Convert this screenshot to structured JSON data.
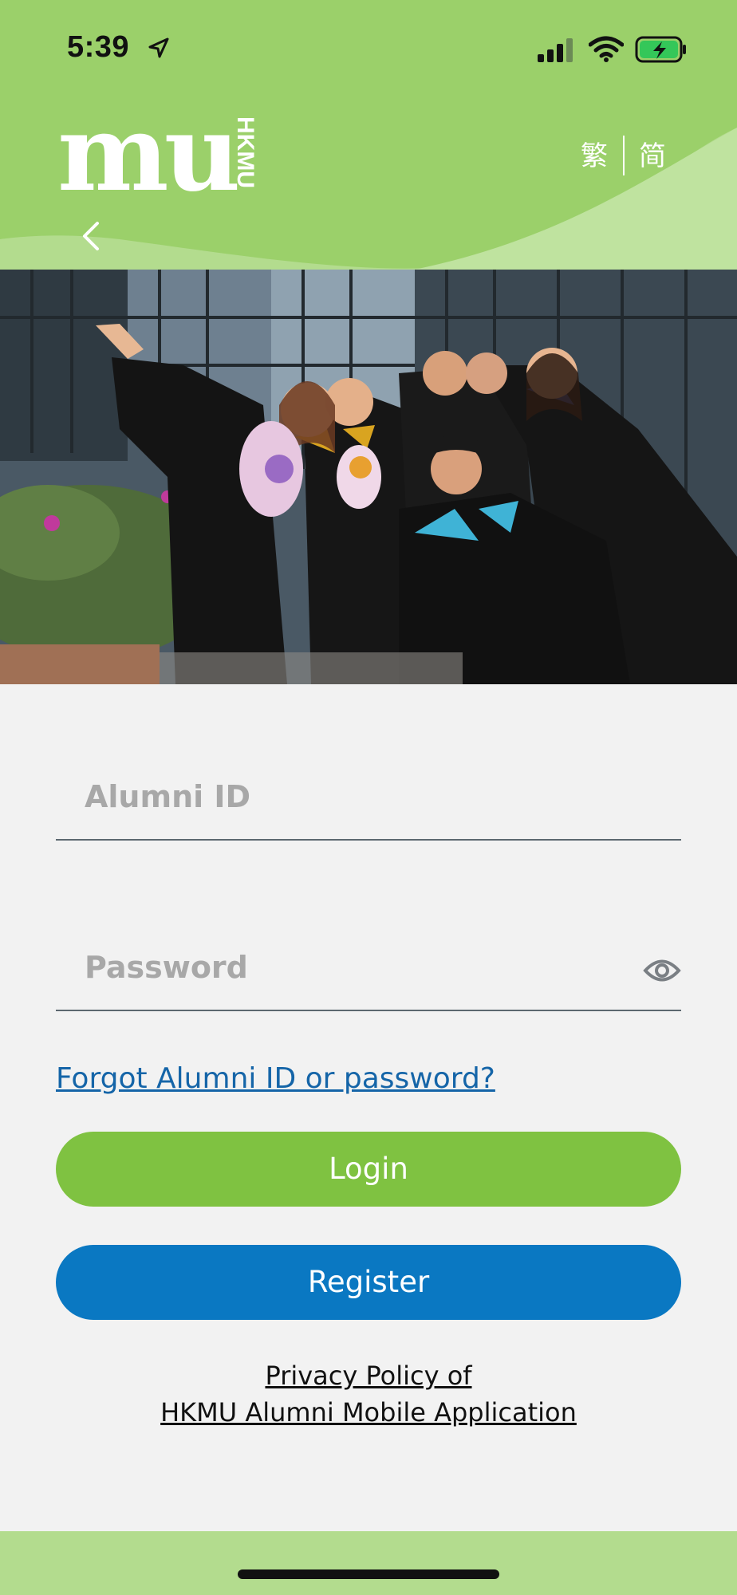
{
  "status_bar": {
    "time": "5:39",
    "icons": [
      "location-arrow-icon",
      "signal-icon",
      "wifi-icon",
      "battery-charging-icon"
    ]
  },
  "header": {
    "logo_text": "mu",
    "logo_side_text": "HKMU",
    "lang_traditional": "繁",
    "lang_simplified": "简",
    "back_icon": "chevron-left-icon"
  },
  "hero": {
    "image": "graduates-group-photo"
  },
  "form": {
    "alumni_id": {
      "placeholder": "Alumni ID",
      "value": ""
    },
    "password": {
      "placeholder": "Password",
      "value": "",
      "toggle_icon": "eye-icon"
    },
    "forgot_link": "Forgot Alumni ID or password?",
    "login_label": "Login",
    "register_label": "Register"
  },
  "privacy": {
    "line1": "Privacy Policy of",
    "line2": "HKMU Alumni Mobile Application"
  },
  "colors": {
    "header_green": "#b3dc8e",
    "login_green": "#7fc241",
    "register_blue": "#0a78c2",
    "link_blue": "#1565a8"
  }
}
